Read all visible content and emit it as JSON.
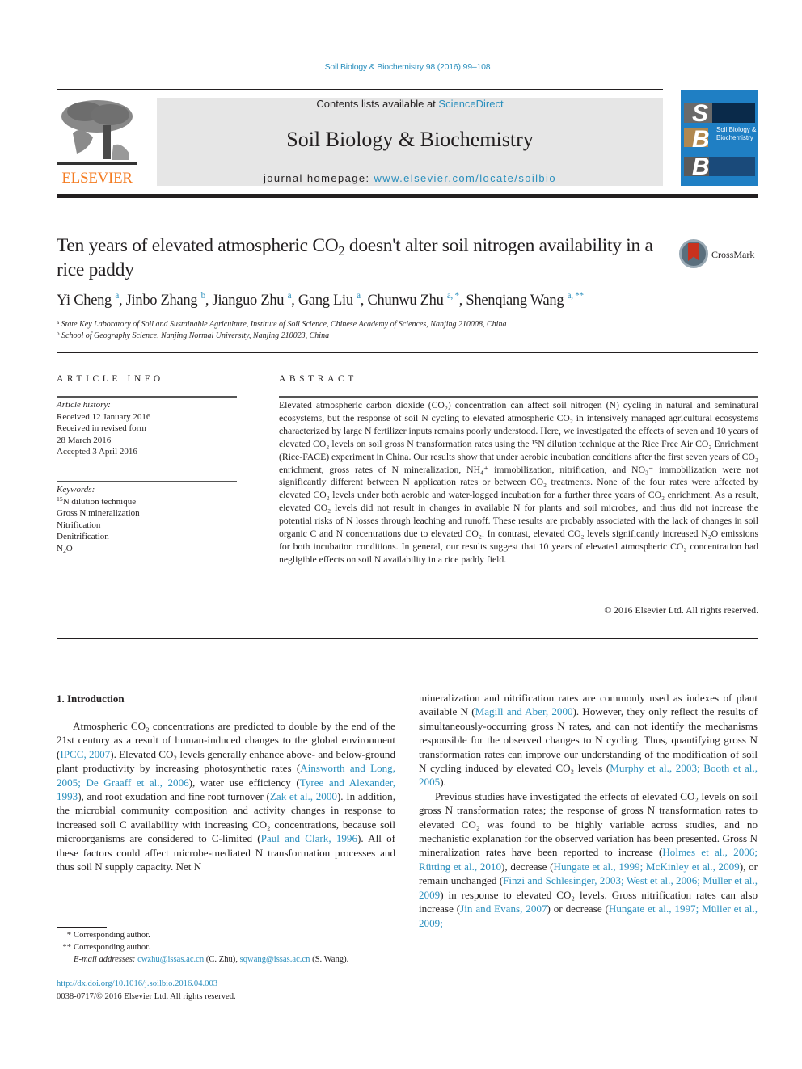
{
  "header": {
    "citation": "Soil Biology & Biochemistry 98 (2016) 99–108",
    "contents_prefix": "Contents lists available at ",
    "contents_link": "ScienceDirect",
    "journal_title": "Soil Biology & Biochemistry",
    "homepage_prefix": "journal homepage: ",
    "homepage_link": "www.elsevier.com/locate/soilbio",
    "publisher_logo": "ELSEVIER",
    "cover": {
      "letters": [
        "S",
        "B",
        "B"
      ],
      "title_line1": "Soil Biology &",
      "title_line2": "Biochemistry",
      "color": "#1f7fc4"
    }
  },
  "article": {
    "title_part1": "Ten years of elevated atmospheric CO",
    "title_sub": "2",
    "title_part2": " doesn't alter soil nitrogen availability in a rice paddy",
    "crossmark_label": "CrossMark",
    "authors": [
      {
        "name": "Yi Cheng",
        "aff": "a"
      },
      {
        "name": "Jinbo Zhang",
        "aff": "b"
      },
      {
        "name": "Jianguo Zhu",
        "aff": "a"
      },
      {
        "name": "Gang Liu",
        "aff": "a"
      },
      {
        "name": "Chunwu Zhu",
        "aff": "a, *"
      },
      {
        "name": "Shenqiang Wang",
        "aff": "a, **"
      }
    ],
    "affiliations": [
      {
        "mark": "a",
        "text": "State Key Laboratory of Soil and Sustainable Agriculture, Institute of Soil Science, Chinese Academy of Sciences, Nanjing 210008, China"
      },
      {
        "mark": "b",
        "text": "School of Geography Science, Nanjing Normal University, Nanjing 210023, China"
      }
    ]
  },
  "article_info": {
    "heading": "ARTICLE INFO",
    "history_label": "Article history:",
    "history": [
      "Received 12 January 2016",
      "Received in revised form",
      "28 March 2016",
      "Accepted 3 April 2016"
    ],
    "keywords_label": "Keywords:",
    "keywords": [
      "15N dilution technique",
      "Gross N mineralization",
      "Nitrification",
      "Denitrification",
      "N2O"
    ]
  },
  "abstract": {
    "heading": "ABSTRACT",
    "text": "Elevated atmospheric carbon dioxide (CO₂) concentration can affect soil nitrogen (N) cycling in natural and seminatural ecosystems, but the response of soil N cycling to elevated atmospheric CO₂ in intensively managed agricultural ecosystems characterized by large N fertilizer inputs remains poorly understood. Here, we investigated the effects of seven and 10 years of elevated CO₂ levels on soil gross N transformation rates using the ¹⁵N dilution technique at the Rice Free Air CO₂ Enrichment (Rice-FACE) experiment in China. Our results show that under aerobic incubation conditions after the first seven years of CO₂ enrichment, gross rates of N mineralization, NH₄⁺ immobilization, nitrification, and NO₃⁻ immobilization were not significantly different between N application rates or between CO₂ treatments. None of the four rates were affected by elevated CO₂ levels under both aerobic and water-logged incubation for a further three years of CO₂ enrichment. As a result, elevated CO₂ levels did not result in changes in available N for plants and soil microbes, and thus did not increase the potential risks of N losses through leaching and runoff. These results are probably associated with the lack of changes in soil organic C and N concentrations due to elevated CO₂. In contrast, elevated CO₂ levels significantly increased N₂O emissions for both incubation conditions. In general, our results suggest that 10 years of elevated atmospheric CO₂ concentration had negligible effects on soil N availability in a rice paddy field.",
    "copyright": "© 2016 Elsevier Ltd. All rights reserved."
  },
  "intro": {
    "heading": "1.  Introduction",
    "left_para": [
      {
        "t": "Atmospheric CO₂ concentrations are predicted to double by the end of the 21st century as a result of human-induced changes to the global environment ("
      },
      {
        "l": "IPCC, 2007"
      },
      {
        "t": "). Elevated CO₂ levels generally enhance above- and below-ground plant productivity by increasing photosynthetic rates ("
      },
      {
        "l": "Ainsworth and Long, 2005; De Graaff et al., 2006"
      },
      {
        "t": "), water use efficiency ("
      },
      {
        "l": "Tyree and Alexander, 1993"
      },
      {
        "t": "), and root exudation and fine root turnover ("
      },
      {
        "l": "Zak et al., 2000"
      },
      {
        "t": "). In addition, the microbial community composition and activity changes in response to increased soil C availability with increasing CO₂ concentrations, because soil microorganisms are considered to C-limited ("
      },
      {
        "l": "Paul and Clark, 1996"
      },
      {
        "t": "). All of these factors could affect microbe-mediated N transformation processes and thus soil N supply capacity. Net N"
      }
    ],
    "right_para1": [
      {
        "t": "mineralization and nitrification rates are commonly used as indexes of plant available N ("
      },
      {
        "l": "Magill and Aber, 2000"
      },
      {
        "t": "). However, they only reflect the results of simultaneously-occurring gross N rates, and can not identify the mechanisms responsible for the observed changes to N cycling. Thus, quantifying gross N transformation rates can improve our understanding of the modification of soil N cycling induced by elevated CO₂ levels ("
      },
      {
        "l": "Murphy et al., 2003; Booth et al., 2005"
      },
      {
        "t": ")."
      }
    ],
    "right_para2": [
      {
        "t": "Previous studies have investigated the effects of elevated CO₂ levels on soil gross N transformation rates; the response of gross N transformation rates to elevated CO₂ was found to be highly variable across studies, and no mechanistic explanation for the observed variation has been presented. Gross N mineralization rates have been reported to increase ("
      },
      {
        "l": "Holmes et al., 2006; Rütting et al., 2010"
      },
      {
        "t": "), decrease ("
      },
      {
        "l": "Hungate et al., 1999; McKinley et al., 2009"
      },
      {
        "t": "), or remain unchanged ("
      },
      {
        "l": "Finzi and Schlesinger, 2003; West et al., 2006; Müller et al., 2009"
      },
      {
        "t": ") in response to elevated CO₂ levels. Gross nitrification rates can also increase ("
      },
      {
        "l": "Jin and Evans, 2007"
      },
      {
        "t": ") or decrease ("
      },
      {
        "l": "Hungate et al., 1997; Müller et al., 2009;"
      }
    ]
  },
  "footnotes": {
    "star1_mark": "*",
    "star1_text": "Corresponding author.",
    "star2_mark": "**",
    "star2_text": "Corresponding author.",
    "email_label": "E-mail addresses:",
    "email1": "cwzhu@issas.ac.cn",
    "email1_name": " (C. Zhu), ",
    "email2": "sqwang@issas.ac.cn",
    "email2_name": " (S. Wang).",
    "doi": "http://dx.doi.org/10.1016/j.soilbio.2016.04.003",
    "issn_copyright": "0038-0717/© 2016 Elsevier Ltd. All rights reserved."
  }
}
